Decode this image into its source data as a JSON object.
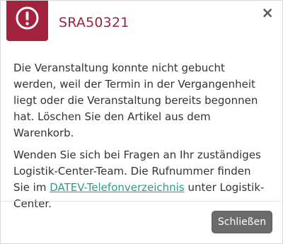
{
  "dialog": {
    "title": "SRA50321",
    "close_symbol": "×",
    "icon": "alert-circle-icon",
    "paragraph1": "Die Veranstaltung konnte nicht gebucht werden, weil der Termin in der Vergangenheit liegt oder die Veranstaltung bereits begonnen hat. Löschen Sie den Artikel aus dem Warenkorb.",
    "paragraph2_before": "Wenden Sie sich bei Fragen an Ihr zuständiges Logistik-Center-Team. Die Rufnummer finden Sie im ",
    "paragraph2_link": "DATEV-Telefonverzeichnis",
    "paragraph2_after": " unter Logistik-Center.",
    "button_label": "Schließen"
  },
  "colors": {
    "accent": "#a3223e",
    "link": "#2a9c8c",
    "button": "#6b6b6b"
  }
}
